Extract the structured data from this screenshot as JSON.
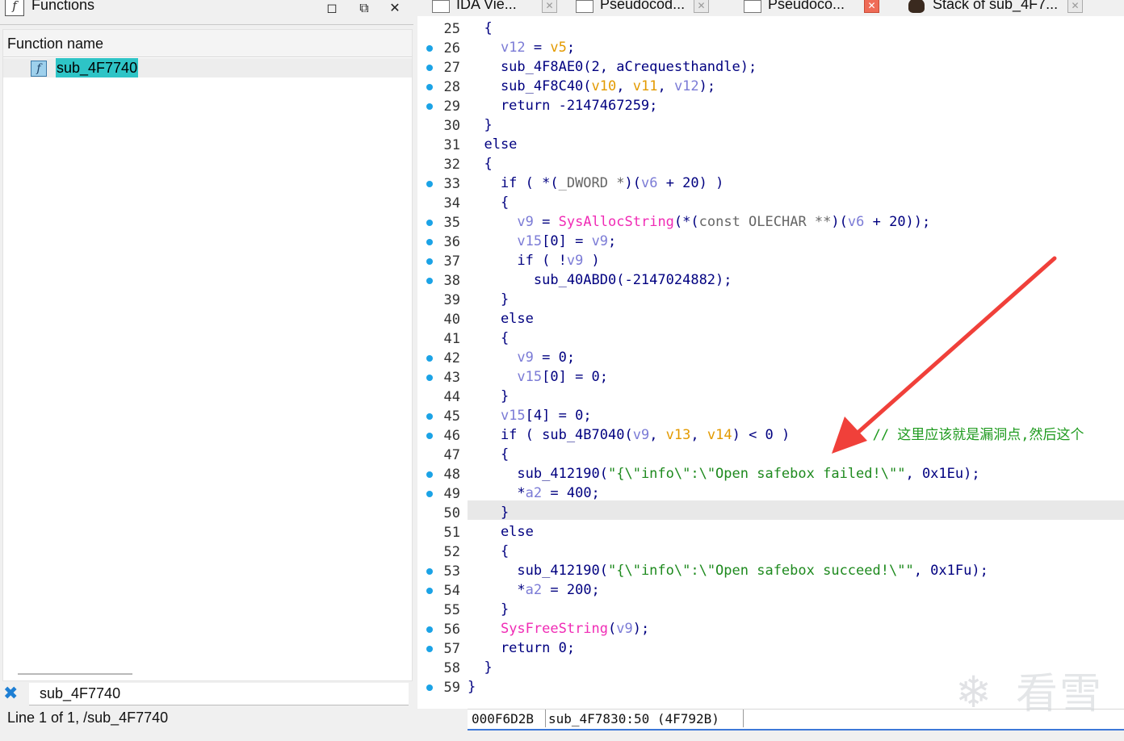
{
  "functions_panel": {
    "title": "Functions",
    "column_header": "Function name",
    "items": [
      {
        "name": "sub_4F7740"
      }
    ],
    "search_value": "sub_4F7740",
    "status": "Line 1 of 1, /sub_4F7740"
  },
  "tabs": [
    {
      "label": "IDA Vie...",
      "active": false
    },
    {
      "label": "Pseudocod...",
      "active": false
    },
    {
      "label": "Pseudoco...",
      "active": true
    },
    {
      "label": "Stack of sub_4F7...",
      "active": false
    }
  ],
  "icons": {
    "function": "f-icon",
    "close": "close-icon",
    "clear": "clear-x-icon",
    "breakpoint": "blue-dot-icon",
    "watermark": "snowflake-logo-icon"
  },
  "colors": {
    "selection": "#2ec4c6",
    "breakpoint_dot": "#1ba3e6",
    "arrow": "#f0403a",
    "string": "#1e8a1e",
    "import": "#f02bb5",
    "variable": "#7b7bd6",
    "argument": "#e39a00"
  },
  "code": {
    "lines": [
      {
        "n": "25",
        "bp": false,
        "tokens": [
          [
            "  {",
            "kw"
          ]
        ]
      },
      {
        "n": "26",
        "bp": true,
        "tokens": [
          [
            "    ",
            "kw"
          ],
          [
            "v12",
            "var"
          ],
          [
            " = ",
            "kw"
          ],
          [
            "v5",
            "arg"
          ],
          [
            ";",
            "kw"
          ]
        ]
      },
      {
        "n": "27",
        "bp": true,
        "tokens": [
          [
            "    sub_4F8AE0(2, aCrequesthandle);",
            "kw"
          ]
        ]
      },
      {
        "n": "28",
        "bp": true,
        "tokens": [
          [
            "    sub_4F8C40(",
            "kw"
          ],
          [
            "v10",
            "arg"
          ],
          [
            ", ",
            "kw"
          ],
          [
            "v11",
            "arg"
          ],
          [
            ", ",
            "kw"
          ],
          [
            "v12",
            "var"
          ],
          [
            ");",
            "kw"
          ]
        ]
      },
      {
        "n": "29",
        "bp": true,
        "tokens": [
          [
            "    return -2147467259;",
            "kw"
          ]
        ]
      },
      {
        "n": "30",
        "bp": false,
        "tokens": [
          [
            "  }",
            "kw"
          ]
        ]
      },
      {
        "n": "31",
        "bp": false,
        "tokens": [
          [
            "  else",
            "kw"
          ]
        ]
      },
      {
        "n": "32",
        "bp": false,
        "tokens": [
          [
            "  {",
            "kw"
          ]
        ]
      },
      {
        "n": "33",
        "bp": true,
        "tokens": [
          [
            "    if ( *(",
            "kw"
          ],
          [
            "_DWORD *",
            "type"
          ],
          [
            ")(",
            "kw"
          ],
          [
            "v6",
            "var"
          ],
          [
            " + 20) )",
            "kw"
          ]
        ]
      },
      {
        "n": "34",
        "bp": false,
        "tokens": [
          [
            "    {",
            "kw"
          ]
        ]
      },
      {
        "n": "35",
        "bp": true,
        "tokens": [
          [
            "      ",
            "kw"
          ],
          [
            "v9",
            "var"
          ],
          [
            " = ",
            "kw"
          ],
          [
            "SysAllocString",
            "imp"
          ],
          [
            "(*(",
            "kw"
          ],
          [
            "const OLECHAR **",
            "type"
          ],
          [
            ")(",
            "kw"
          ],
          [
            "v6",
            "var"
          ],
          [
            " + 20));",
            "kw"
          ]
        ]
      },
      {
        "n": "36",
        "bp": true,
        "tokens": [
          [
            "      ",
            "kw"
          ],
          [
            "v15",
            "var"
          ],
          [
            "[0] = ",
            "kw"
          ],
          [
            "v9",
            "var"
          ],
          [
            ";",
            "kw"
          ]
        ]
      },
      {
        "n": "37",
        "bp": true,
        "tokens": [
          [
            "      if ( !",
            "kw"
          ],
          [
            "v9",
            "var"
          ],
          [
            " )",
            "kw"
          ]
        ]
      },
      {
        "n": "38",
        "bp": true,
        "tokens": [
          [
            "        sub_40ABD0(-2147024882);",
            "kw"
          ]
        ]
      },
      {
        "n": "39",
        "bp": false,
        "tokens": [
          [
            "    }",
            "kw"
          ]
        ]
      },
      {
        "n": "40",
        "bp": false,
        "tokens": [
          [
            "    else",
            "kw"
          ]
        ]
      },
      {
        "n": "41",
        "bp": false,
        "tokens": [
          [
            "    {",
            "kw"
          ]
        ]
      },
      {
        "n": "42",
        "bp": true,
        "tokens": [
          [
            "      ",
            "kw"
          ],
          [
            "v9",
            "var"
          ],
          [
            " = 0;",
            "kw"
          ]
        ]
      },
      {
        "n": "43",
        "bp": true,
        "tokens": [
          [
            "      ",
            "kw"
          ],
          [
            "v15",
            "var"
          ],
          [
            "[0] = 0;",
            "kw"
          ]
        ]
      },
      {
        "n": "44",
        "bp": false,
        "tokens": [
          [
            "    }",
            "kw"
          ]
        ]
      },
      {
        "n": "45",
        "bp": true,
        "tokens": [
          [
            "    ",
            "kw"
          ],
          [
            "v15",
            "var"
          ],
          [
            "[4] = 0;",
            "kw"
          ]
        ]
      },
      {
        "n": "46",
        "bp": true,
        "tokens": [
          [
            "    if ( sub_4B7040(",
            "kw"
          ],
          [
            "v9",
            "var"
          ],
          [
            ", ",
            "kw"
          ],
          [
            "v13",
            "arg"
          ],
          [
            ", ",
            "kw"
          ],
          [
            "v14",
            "arg"
          ],
          [
            ") < 0 )",
            "kw"
          ],
          [
            "          // 这里应该就是漏洞点,然后这个",
            "cmt"
          ]
        ]
      },
      {
        "n": "47",
        "bp": false,
        "tokens": [
          [
            "    {",
            "kw"
          ]
        ]
      },
      {
        "n": "48",
        "bp": true,
        "tokens": [
          [
            "      sub_412190(",
            "kw"
          ],
          [
            "\"{\\\"info\\\":\\\"Open safebox failed!\\\"\"",
            "str"
          ],
          [
            ", 0x1Eu);",
            "kw"
          ]
        ]
      },
      {
        "n": "49",
        "bp": true,
        "tokens": [
          [
            "      *",
            "kw"
          ],
          [
            "a2",
            "var"
          ],
          [
            " = 400;",
            "kw"
          ]
        ]
      },
      {
        "n": "50",
        "bp": false,
        "tokens": [
          [
            "    }",
            "kw"
          ]
        ]
      },
      {
        "n": "51",
        "bp": false,
        "tokens": [
          [
            "    else",
            "kw"
          ]
        ]
      },
      {
        "n": "52",
        "bp": false,
        "tokens": [
          [
            "    {",
            "kw"
          ]
        ]
      },
      {
        "n": "53",
        "bp": true,
        "tokens": [
          [
            "      sub_412190(",
            "kw"
          ],
          [
            "\"{\\\"info\\\":\\\"Open safebox succeed!\\\"\"",
            "str"
          ],
          [
            ", 0x1Fu);",
            "kw"
          ]
        ]
      },
      {
        "n": "54",
        "bp": true,
        "tokens": [
          [
            "      *",
            "kw"
          ],
          [
            "a2",
            "var"
          ],
          [
            " = 200;",
            "kw"
          ]
        ]
      },
      {
        "n": "55",
        "bp": false,
        "tokens": [
          [
            "    }",
            "kw"
          ]
        ]
      },
      {
        "n": "56",
        "bp": true,
        "tokens": [
          [
            "    ",
            "kw"
          ],
          [
            "SysFreeString",
            "imp"
          ],
          [
            "(",
            "kw"
          ],
          [
            "v9",
            "var"
          ],
          [
            ");",
            "kw"
          ]
        ]
      },
      {
        "n": "57",
        "bp": true,
        "tokens": [
          [
            "    return 0;",
            "kw"
          ]
        ]
      },
      {
        "n": "58",
        "bp": false,
        "tokens": [
          [
            "  }",
            "kw"
          ]
        ]
      },
      {
        "n": "59",
        "bp": true,
        "tokens": [
          [
            "}",
            "kw"
          ]
        ]
      }
    ],
    "highlighted_line": "50"
  },
  "address_bar": {
    "address": "000F6D2B",
    "location": "sub_4F7830:50 (4F792B)"
  },
  "watermark": {
    "text": "看雪"
  }
}
